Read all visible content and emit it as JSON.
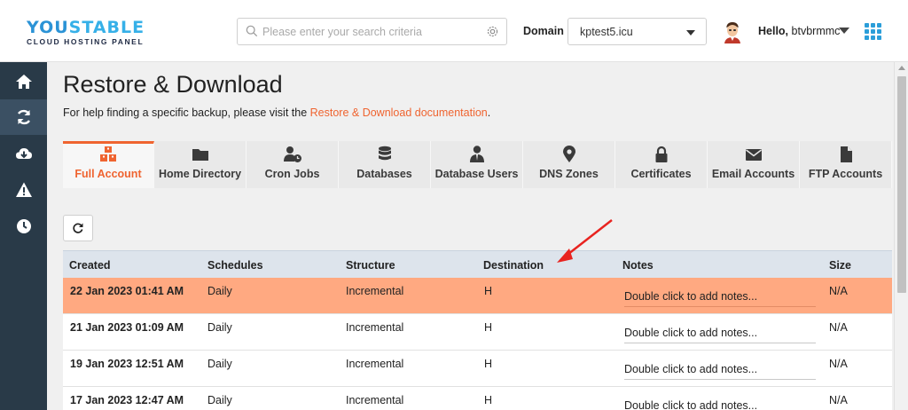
{
  "brand": {
    "name_part1": "YOU",
    "name_part2": "STABLE",
    "tagline": "CLOUD HOSTING PANEL"
  },
  "header": {
    "search_placeholder": "Please enter your search criteria",
    "domain_label": "Domain",
    "domain_value": "kptest5.icu",
    "greeting": "Hello,",
    "username": "btvbrmmc"
  },
  "sidebar": {
    "items": [
      {
        "icon": "home-icon"
      },
      {
        "icon": "refresh-icon",
        "active": true
      },
      {
        "icon": "cloud-download-icon"
      },
      {
        "icon": "warning-icon"
      },
      {
        "icon": "clock-icon"
      }
    ]
  },
  "page": {
    "title": "Restore & Download",
    "help_prefix": "For help finding a specific backup, please visit the ",
    "help_link": "Restore & Download documentation",
    "help_suffix": "."
  },
  "tabs": [
    {
      "label": "Full Account",
      "icon": "boxes-icon",
      "active": true
    },
    {
      "label": "Home Directory",
      "icon": "folder-icon"
    },
    {
      "label": "Cron Jobs",
      "icon": "user-clock-icon"
    },
    {
      "label": "Databases",
      "icon": "database-icon"
    },
    {
      "label": "Database Users",
      "icon": "user-tie-icon"
    },
    {
      "label": "DNS Zones",
      "icon": "map-marker-icon"
    },
    {
      "label": "Certificates",
      "icon": "lock-icon"
    },
    {
      "label": "Email Accounts",
      "icon": "envelope-icon"
    },
    {
      "label": "FTP Accounts",
      "icon": "file-icon"
    }
  ],
  "table": {
    "columns": [
      "Created",
      "Schedules",
      "Structure",
      "Destination",
      "Notes",
      "Size"
    ],
    "rows": [
      {
        "created": "22 Jan 2023 01:41 AM",
        "schedule": "Daily",
        "structure": "Incremental",
        "destination": "H",
        "notes": "Double click to add notes...",
        "size": "N/A"
      },
      {
        "created": "21 Jan 2023 01:09 AM",
        "schedule": "Daily",
        "structure": "Incremental",
        "destination": "H",
        "notes": "Double click to add notes...",
        "size": "N/A"
      },
      {
        "created": "19 Jan 2023 12:51 AM",
        "schedule": "Daily",
        "structure": "Incremental",
        "destination": "H",
        "notes": "Double click to add notes...",
        "size": "N/A"
      },
      {
        "created": "17 Jan 2023 12:47 AM",
        "schedule": "Daily",
        "structure": "Incremental",
        "destination": "H",
        "notes": "Double click to add notes...",
        "size": "N/A"
      }
    ]
  },
  "colors": {
    "accent": "#ef6430",
    "selected_row": "#ffa981",
    "sidebar": "#293a48",
    "annotation_arrow": "#e8231f"
  }
}
